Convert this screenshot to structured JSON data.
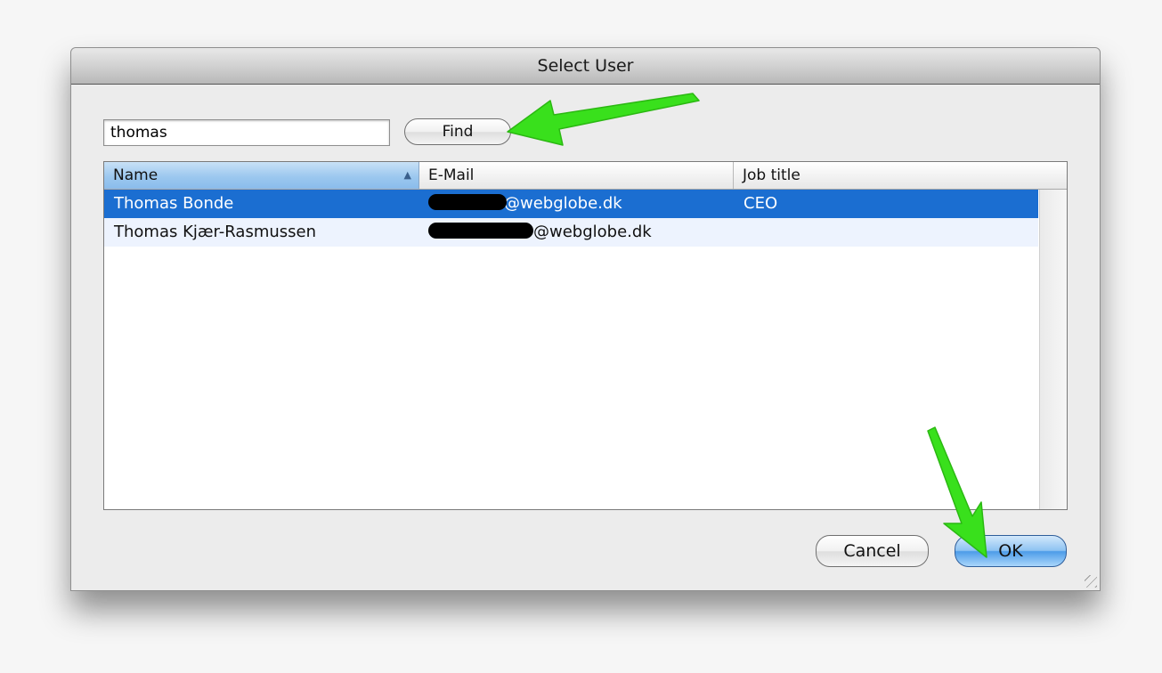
{
  "dialog": {
    "title": "Select User"
  },
  "search": {
    "value": "thomas",
    "find_label": "Find"
  },
  "table": {
    "columns": [
      {
        "label": "Name",
        "sorted": "ascending"
      },
      {
        "label": "E-Mail"
      },
      {
        "label": "Job title"
      }
    ],
    "rows": [
      {
        "name": "Thomas Bonde",
        "email_domain": "@webglobe.dk",
        "job_title": "CEO",
        "selected": true
      },
      {
        "name": "Thomas Kjær-Rasmussen",
        "email_domain": "@webglobe.dk",
        "job_title": "",
        "selected": false
      }
    ]
  },
  "buttons": {
    "cancel": "Cancel",
    "ok": "OK"
  },
  "annotations": {
    "arrow_color": "#39e01c"
  }
}
